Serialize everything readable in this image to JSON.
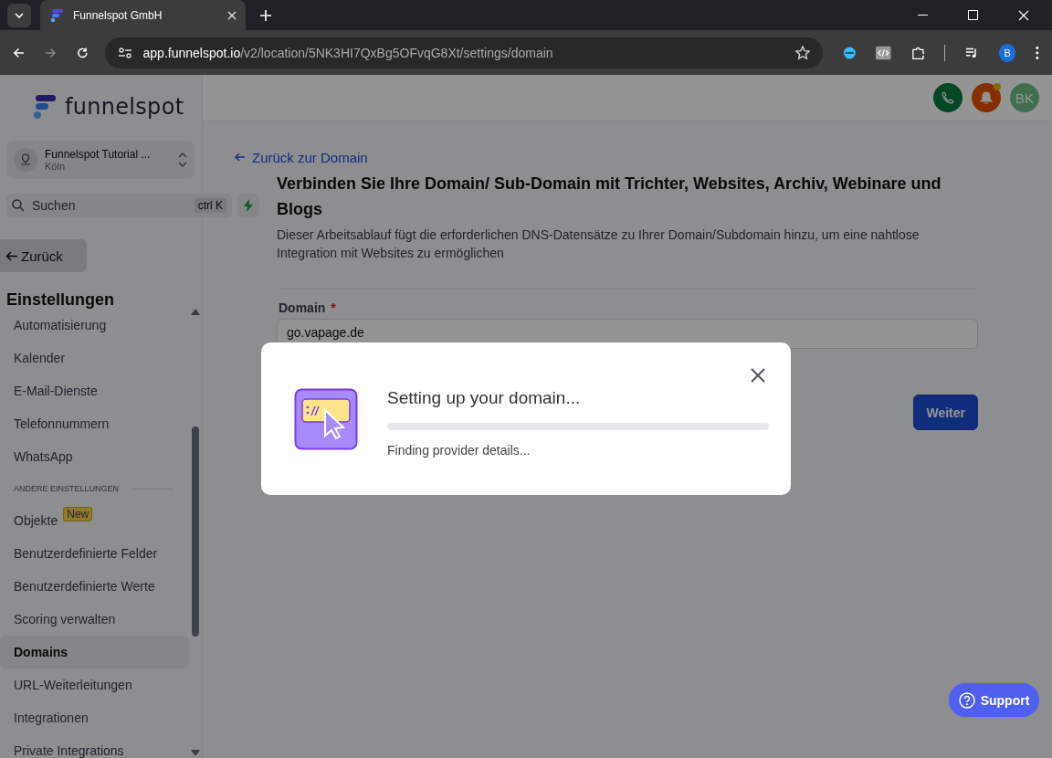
{
  "browser": {
    "tab_title": "Funnelspot GmbH",
    "url_host": "app.funnelspot.io",
    "url_path": "/v2/location/5NK3HI7QxBg5OFvqG8Xt/settings/domain",
    "profile_initial": "B"
  },
  "sidebar": {
    "logo_text": "funnelspot",
    "account": {
      "name": "Funnelspot Tutorial ...",
      "location": "Köln"
    },
    "search": {
      "placeholder": "Suchen",
      "shortcut": "ctrl K"
    },
    "back_button": "Zurück",
    "section_title": "Einstellungen",
    "items": [
      {
        "kind": "item",
        "label": "Automatisierung",
        "selected": false
      },
      {
        "kind": "item",
        "label": "Kalender",
        "selected": false
      },
      {
        "kind": "item",
        "label": "E-Mail-Dienste",
        "selected": false
      },
      {
        "kind": "item",
        "label": "Telefonnummern",
        "selected": false
      },
      {
        "kind": "item",
        "label": "WhatsApp",
        "selected": false
      },
      {
        "kind": "heading",
        "label": "ANDERE EINSTELLUNGEN"
      },
      {
        "kind": "item",
        "label": "Objekte",
        "selected": false,
        "badge": "New"
      },
      {
        "kind": "item",
        "label": "Benutzerdefinierte Felder",
        "selected": false
      },
      {
        "kind": "item",
        "label": "Benutzerdefinierte Werte",
        "selected": false
      },
      {
        "kind": "item",
        "label": "Scoring verwalten",
        "selected": false
      },
      {
        "kind": "item",
        "label": "Domains",
        "selected": true
      },
      {
        "kind": "item",
        "label": "URL-Weiterleitungen",
        "selected": false
      },
      {
        "kind": "item",
        "label": "Integrationen",
        "selected": false
      },
      {
        "kind": "item",
        "label": "Private Integrations",
        "selected": false
      }
    ]
  },
  "header": {
    "avatar": "BK",
    "notification_dot": true
  },
  "page": {
    "back_link": "Zurück zur Domain",
    "title": "Verbinden Sie Ihre Domain/ Sub-Domain mit Trichter, Websites, Archiv, Webinare und Blogs",
    "description": "Dieser Arbeitsablauf fügt die erforderlichen DNS-Datensätze zu Ihrer Domain/Subdomain hinzu, um eine nahtlose Integration mit Websites zu ermöglichen",
    "field": {
      "label": "Domain",
      "required_mark": "*",
      "value": "go.vapage.de"
    },
    "next_button": "Weiter"
  },
  "modal": {
    "title": "Setting up your domain...",
    "progress": {
      "level": 0
    },
    "status": "Finding provider details..."
  },
  "support_button": "Support"
}
